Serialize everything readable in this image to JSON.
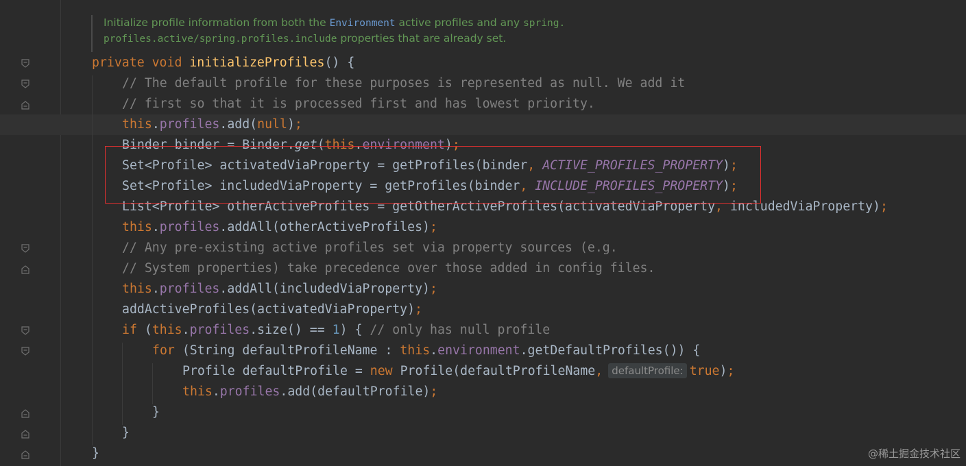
{
  "doc_comment": {
    "text1": "Initialize profile information from both the ",
    "link": "Environment",
    "text2": " active profiles and any ",
    "code1": "spring.",
    "code2": "profiles.active",
    "slash": "/",
    "code3": "spring.profiles.include",
    "text3": " properties that are already set."
  },
  "code": {
    "l1": {
      "kw": "private void ",
      "fn": "initializeProfiles",
      "rest": "() {"
    },
    "l2": "// The default profile for these purposes is represented as null. We add it",
    "l3": "// first so that it is processed first and has lowest priority.",
    "l4": {
      "kw": "this",
      "dot": ".",
      "field": "profiles",
      "call": ".add(",
      "kw2": "null",
      "end": ")",
      "semi": ";"
    },
    "l5": {
      "a": "Binder binder = Binder.",
      "b": "get",
      "c": "(",
      "kw": "this",
      "d": ".",
      "field": "environment",
      "e": ")",
      "semi": ";"
    },
    "l6": {
      "a": "Set<Profile> activatedViaProperty = getProfiles(binder",
      "comma": ", ",
      "const": "ACTIVE_PROFILES_PROPERTY",
      "e": ")",
      "semi": ";"
    },
    "l7": {
      "a": "Set<Profile> includedViaProperty = getProfiles(binder",
      "comma": ", ",
      "const": "INCLUDE_PROFILES_PROPERTY",
      "e": ")",
      "semi": ";"
    },
    "l8": {
      "a": "List<Profile> otherActiveProfiles = getOtherActiveProfiles(activatedViaProperty",
      "comma": ", ",
      "b": "includedViaProperty)",
      "semi": ";"
    },
    "l9": {
      "kw": "this",
      "dot": ".",
      "field": "profiles",
      "rest": ".addAll(otherActiveProfiles)",
      "semi": ";"
    },
    "l10": "// Any pre-existing active profiles set via property sources (e.g.",
    "l11": "// System properties) take precedence over those added in config files.",
    "l12": {
      "kw": "this",
      "dot": ".",
      "field": "profiles",
      "rest": ".addAll(includedViaProperty)",
      "semi": ";"
    },
    "l13": {
      "a": "addActiveProfiles(activatedViaProperty)",
      "semi": ";"
    },
    "l14": {
      "kw": "if ",
      "a": "(",
      "kw2": "this",
      "dot": ".",
      "field": "profiles",
      "b": ".size() == ",
      "num": "1",
      "c": ") { ",
      "cmt": "// only has null profile"
    },
    "l15": {
      "kw": "for ",
      "a": "(String defaultProfileName : ",
      "kw2": "this",
      "dot": ".",
      "field": "environment",
      "b": ".getDefaultProfiles()) {"
    },
    "l16": {
      "a": "Profile defaultProfile = ",
      "kw": "new ",
      "b": "Profile(defaultProfileName",
      "comma": ",",
      "hint": "defaultProfile:",
      "kw2": "true",
      "c": ")",
      "semi": ";"
    },
    "l17": {
      "kw": "this",
      "dot": ".",
      "field": "profiles",
      "rest": ".add(defaultProfile)",
      "semi": ";"
    },
    "l18": "}",
    "l19": "}",
    "l20": "}"
  },
  "watermark": "@稀土掘金技术社区"
}
